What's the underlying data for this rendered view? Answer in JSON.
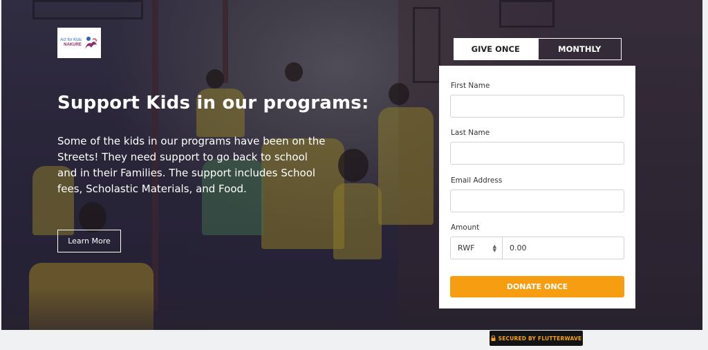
{
  "logo": {
    "line1": "Act for Kids",
    "line2": "NAKURE",
    "alt": "Act for Kids logo"
  },
  "hero": {
    "title": "Support Kids in our programs:",
    "description": "Some of the kids in our programs have been on the Streets! They need support to go back to school and in their Families. The support includes School fees, Scholastic Materials, and Food.",
    "learn_more_label": "Learn More"
  },
  "tabs": [
    {
      "label": "GIVE ONCE",
      "active": true
    },
    {
      "label": "MONTHLY",
      "active": false
    }
  ],
  "form": {
    "first_name_label": "First Name",
    "first_name_value": "",
    "last_name_label": "Last Name",
    "last_name_value": "",
    "email_label": "Email Address",
    "email_value": "",
    "amount_label": "Amount",
    "currency": "RWF",
    "amount_value": "0.00",
    "donate_label": "DONATE ONCE"
  },
  "footer": {
    "secured_label": "SECURED BY FLUTTERWAVE"
  },
  "colors": {
    "accent": "#f79d12",
    "secured_text": "#f3a31c",
    "logo_blue": "#2a66b5",
    "logo_purple": "#8b2d6b"
  },
  "icons": [
    "lock-icon",
    "logo-mark-icon",
    "stepper-icon"
  ]
}
